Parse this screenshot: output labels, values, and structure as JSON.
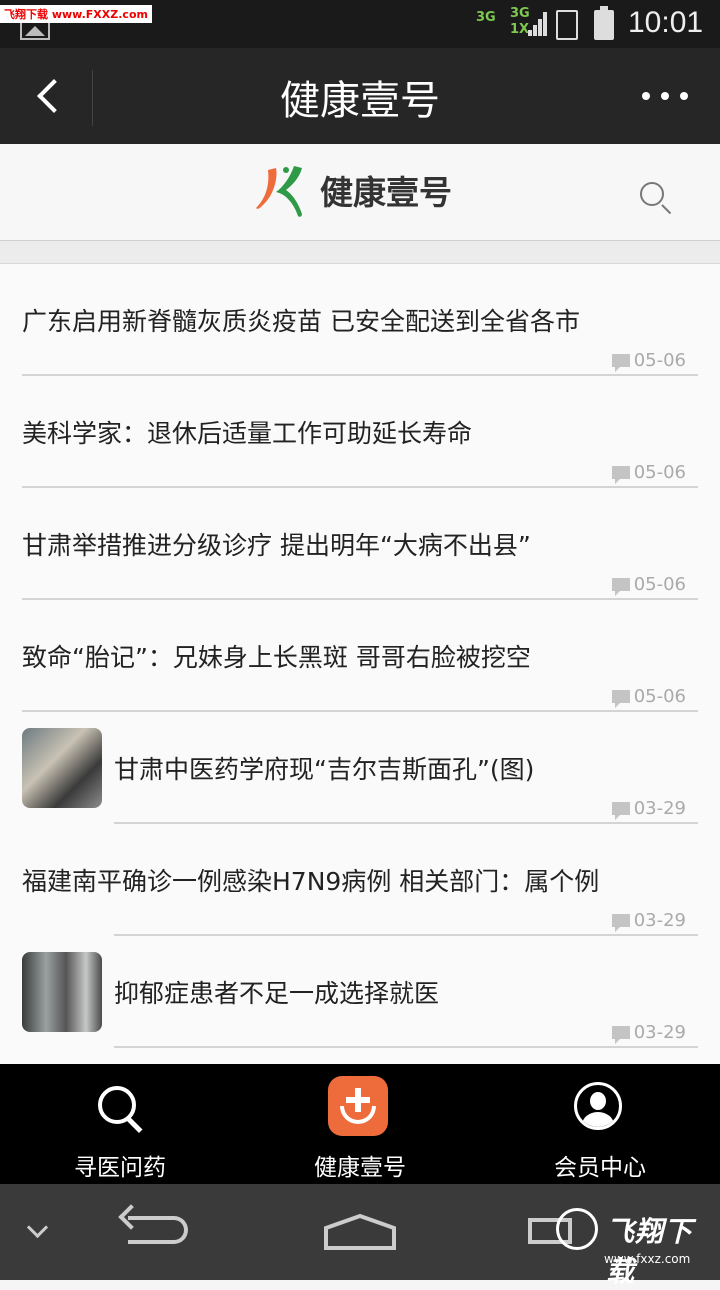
{
  "status_bar": {
    "watermark": "飞翔下载 www.FXXZ.com",
    "network1": "3G",
    "network2": "3G",
    "network3": "1X",
    "time": "10:01"
  },
  "title_bar": {
    "title": "健康壹号",
    "back_icon": "back-arrow-icon",
    "more_icon": "more-dots-icon"
  },
  "header": {
    "brand": "健康壹号",
    "logo_icon": "jk-logo-icon",
    "search_icon": "search-icon"
  },
  "articles": [
    {
      "title": "广东启用新脊髓灰质炎疫苗 已安全配送到全省各市",
      "date": "05-06",
      "thumbnail": false
    },
    {
      "title": "美科学家：退休后适量工作可助延长寿命",
      "date": "05-06",
      "thumbnail": false
    },
    {
      "title": "甘肃举措推进分级诊疗 提出明年“大病不出县”",
      "date": "05-06",
      "thumbnail": false
    },
    {
      "title": "致命“胎记”：兄妹身上长黑斑 哥哥右脸被挖空",
      "date": "05-06",
      "thumbnail": false
    },
    {
      "title": "甘肃中医药学府现“吉尔吉斯面孔”(图)",
      "date": "03-29",
      "thumbnail": true
    },
    {
      "title": "福建南平确诊一例感染H7N9病例 相关部门：属个例",
      "date": "03-29",
      "thumbnail": false
    },
    {
      "title": "抑郁症患者不足一成选择就医",
      "date": "03-29",
      "thumbnail": true
    }
  ],
  "bottom_nav": [
    {
      "label": "寻医问药",
      "icon": "search-icon"
    },
    {
      "label": "健康壹号",
      "icon": "health-plus-icon"
    },
    {
      "label": "会员中心",
      "icon": "user-icon"
    }
  ],
  "watermark_footer": {
    "text": "飞翔下载",
    "sub": "www.fxxz.com"
  },
  "colors": {
    "accent": "#ee6b3c",
    "logo_green": "#2e9a47",
    "title_bar": "#262626"
  }
}
